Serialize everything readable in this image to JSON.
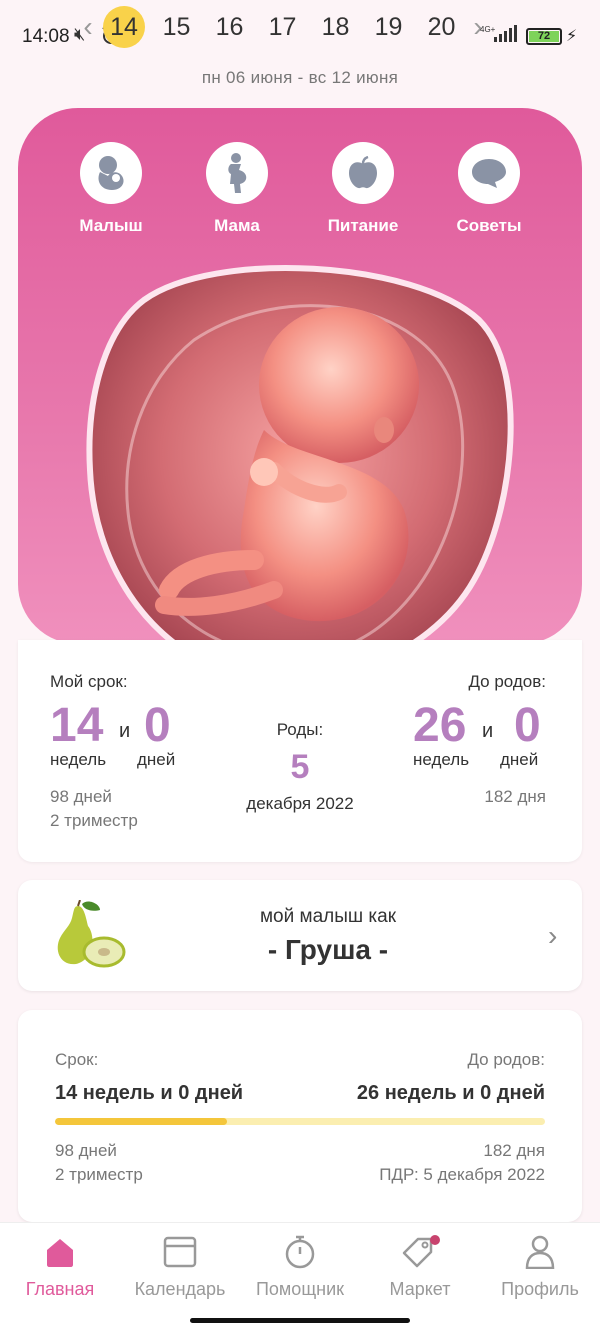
{
  "status_bar": {
    "time": "14:08",
    "network": "4G+",
    "battery": "72",
    "icons": [
      "mute-icon",
      "alarm-icon",
      "signal-icon",
      "battery-icon",
      "charging-icon"
    ]
  },
  "week_strip": {
    "days": [
      "14",
      "15",
      "16",
      "17",
      "18",
      "19",
      "20"
    ],
    "selected": "14",
    "range": "пн 06 июня - вс 12 июня"
  },
  "hero": {
    "tabs": [
      {
        "label": "Малыш",
        "icon": "baby-icon"
      },
      {
        "label": "Мама",
        "icon": "mother-icon"
      },
      {
        "label": "Питание",
        "icon": "apple-icon"
      },
      {
        "label": "Советы",
        "icon": "chat-icon"
      }
    ],
    "image": "fetus-illustration"
  },
  "term": {
    "my_term_label": "Мой срок:",
    "weeks": "14",
    "and": "и",
    "days": "0",
    "weeks_unit": "недель",
    "days_unit": "дней",
    "total_days": "98 дней",
    "trimester": "2 триместр",
    "birth_label": "Роды:",
    "birth_day": "5",
    "birth_month_year": "декабря 2022",
    "until_label": "До родов:",
    "until_weeks": "26",
    "until_days": "0",
    "until_total_days": "182 дня"
  },
  "fruit": {
    "caption": "мой малыш как",
    "name": "- Груша -",
    "icon": "pear-icon"
  },
  "progress": {
    "term_label": "Срок:",
    "term_value": "14 недель и 0 дней",
    "until_label": "До родов:",
    "until_value": "26 недель и 0 дней",
    "fraction": 0.35,
    "days_passed": "98 дней",
    "trimester": "2 триместр",
    "days_left": "182 дня",
    "due_date": "ПДР: 5 декабря 2022"
  },
  "colors": {
    "accent": "#e05a9b",
    "number": "#b57fbe",
    "progress": "#f4c63b",
    "selected_day": "#f9d24a"
  },
  "nav": [
    {
      "label": "Главная",
      "icon": "home-icon",
      "active": true
    },
    {
      "label": "Календарь",
      "icon": "calendar-icon",
      "active": false
    },
    {
      "label": "Помощник",
      "icon": "timer-icon",
      "active": false
    },
    {
      "label": "Маркет",
      "icon": "tag-icon",
      "active": false
    },
    {
      "label": "Профиль",
      "icon": "profile-icon",
      "active": false
    }
  ]
}
